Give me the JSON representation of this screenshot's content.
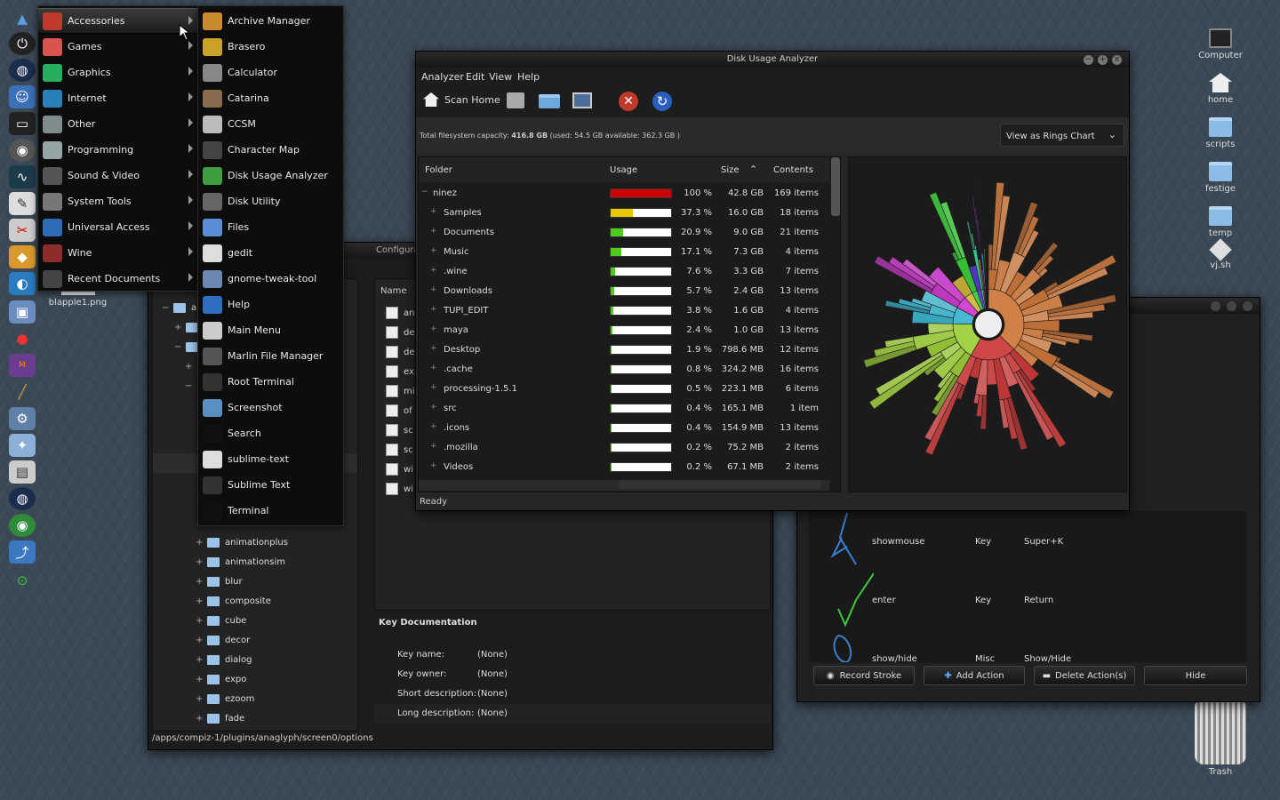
{
  "apps_menu": {
    "categories": [
      {
        "label": "Accessories",
        "icon": "accessories-icon",
        "color": "#c0392b"
      },
      {
        "label": "Games",
        "icon": "games-icon",
        "color": "#d9534f"
      },
      {
        "label": "Graphics",
        "icon": "graphics-icon",
        "color": "#27ae60"
      },
      {
        "label": "Internet",
        "icon": "internet-icon",
        "color": "#2980b9"
      },
      {
        "label": "Other",
        "icon": "other-icon",
        "color": "#7f8c8d"
      },
      {
        "label": "Programming",
        "icon": "programming-icon",
        "color": "#95a5a6"
      },
      {
        "label": "Sound & Video",
        "icon": "sound-video-icon",
        "color": "#555"
      },
      {
        "label": "System Tools",
        "icon": "system-tools-icon",
        "color": "#777"
      },
      {
        "label": "Universal Access",
        "icon": "universal-access-icon",
        "color": "#2c6db5"
      },
      {
        "label": "Wine",
        "icon": "wine-icon",
        "color": "#8e2b2b"
      },
      {
        "label": "Recent Documents",
        "icon": "recent-documents-icon",
        "color": "#444"
      }
    ],
    "accessories": [
      {
        "label": "Archive Manager",
        "icon": "archive-icon",
        "color": "#c98a2e"
      },
      {
        "label": "Brasero",
        "icon": "brasero-icon",
        "color": "#c9a226"
      },
      {
        "label": "Calculator",
        "icon": "calculator-icon",
        "color": "#888"
      },
      {
        "label": "Catarina",
        "icon": "catarina-icon",
        "color": "#8a6b4e"
      },
      {
        "label": "CCSM",
        "icon": "ccsm-icon",
        "color": "#bbb"
      },
      {
        "label": "Character Map",
        "icon": "character-map-icon",
        "color": "#444"
      },
      {
        "label": "Disk Usage Analyzer",
        "icon": "disk-usage-icon",
        "color": "#3f9e3f"
      },
      {
        "label": "Disk Utility",
        "icon": "disk-utility-icon",
        "color": "#666"
      },
      {
        "label": "Files",
        "icon": "files-icon",
        "color": "#5b8dd6"
      },
      {
        "label": "gedit",
        "icon": "gedit-icon",
        "color": "#ddd"
      },
      {
        "label": "gnome-tweak-tool",
        "icon": "tweak-tool-icon",
        "color": "#6a88b0"
      },
      {
        "label": "Help",
        "icon": "help-icon",
        "color": "#2f6fc0"
      },
      {
        "label": "Main Menu",
        "icon": "main-menu-icon",
        "color": "#ccc"
      },
      {
        "label": "Marlin File Manager",
        "icon": "marlin-icon",
        "color": "#555"
      },
      {
        "label": "Root Terminal",
        "icon": "root-terminal-icon",
        "color": "#333"
      },
      {
        "label": "Screenshot",
        "icon": "screenshot-icon",
        "color": "#5a8fc0"
      },
      {
        "label": "Search",
        "icon": "search-icon",
        "color": "#111"
      },
      {
        "label": "sublime-text",
        "icon": "sublime-text-icon",
        "color": "#ddd"
      },
      {
        "label": "Sublime Text",
        "icon": "sublime-icon",
        "color": "#333"
      },
      {
        "label": "Terminal",
        "icon": "terminal-icon",
        "color": "#111"
      }
    ]
  },
  "desktop": {
    "icons": [
      {
        "label": "Computer",
        "icon": "computer-icon"
      },
      {
        "label": "home",
        "icon": "home-icon"
      },
      {
        "label": "scripts",
        "icon": "folder-icon"
      },
      {
        "label": "festige",
        "icon": "folder-icon"
      },
      {
        "label": "temp",
        "icon": "folder-icon"
      },
      {
        "label": "vj.sh",
        "icon": "script-icon"
      }
    ],
    "trash": "Trash",
    "file": "blapple1.png"
  },
  "baobab": {
    "title": "Disk Usage Analyzer",
    "menu": [
      "Analyzer",
      "Edit",
      "View",
      "Help"
    ],
    "toolbar": {
      "scan_home": "Scan Home"
    },
    "capacity_prefix": "Total filesystem capacity: ",
    "capacity_value": "416.8 GB",
    "capacity_suffix": " (used: 54.5 GB available: 362.3 GB )",
    "view_select": "View as Rings Chart",
    "columns": {
      "folder": "Folder",
      "usage": "Usage",
      "size": "Size",
      "contents": "Contents"
    },
    "rows": [
      {
        "exp": "−",
        "name": "ninez",
        "pct": "100 %",
        "size": "42.8 GB",
        "contents": "169 items",
        "fill": 1.0,
        "color": "#cc0000"
      },
      {
        "exp": "+",
        "name": "Samples",
        "pct": "37.3 %",
        "size": "16.0 GB",
        "contents": "18 items",
        "fill": 0.373,
        "color": "#e6c800"
      },
      {
        "exp": "+",
        "name": "Documents",
        "pct": "20.9 %",
        "size": "9.0 GB",
        "contents": "21 items",
        "fill": 0.209,
        "color": "#4ecc1e"
      },
      {
        "exp": "+",
        "name": "Music",
        "pct": "17.1 %",
        "size": "7.3 GB",
        "contents": "4 items",
        "fill": 0.171,
        "color": "#4ecc1e"
      },
      {
        "exp": "+",
        "name": ".wine",
        "pct": "7.6 %",
        "size": "3.3 GB",
        "contents": "7 items",
        "fill": 0.076,
        "color": "#4ecc1e"
      },
      {
        "exp": "+",
        "name": "Downloads",
        "pct": "5.7 %",
        "size": "2.4 GB",
        "contents": "13 items",
        "fill": 0.057,
        "color": "#4ecc1e"
      },
      {
        "exp": "+",
        "name": "TUPI_EDIT",
        "pct": "3.8 %",
        "size": "1.6 GB",
        "contents": "4 items",
        "fill": 0.038,
        "color": "#4ecc1e"
      },
      {
        "exp": "+",
        "name": "maya",
        "pct": "2.4 %",
        "size": "1.0 GB",
        "contents": "13 items",
        "fill": 0.024,
        "color": "#4ecc1e"
      },
      {
        "exp": "+",
        "name": "Desktop",
        "pct": "1.9 %",
        "size": "798.6 MB",
        "contents": "12 items",
        "fill": 0.019,
        "color": "#4ecc1e"
      },
      {
        "exp": "+",
        "name": ".cache",
        "pct": "0.8 %",
        "size": "324.2 MB",
        "contents": "16 items",
        "fill": 0.008,
        "color": "#4ecc1e"
      },
      {
        "exp": "+",
        "name": "processing-1.5.1",
        "pct": "0.5 %",
        "size": "223.1 MB",
        "contents": "6 items",
        "fill": 0.005,
        "color": "#4ecc1e"
      },
      {
        "exp": "+",
        "name": "src",
        "pct": "0.4 %",
        "size": "165.1 MB",
        "contents": "1 item",
        "fill": 0.004,
        "color": "#4ecc1e"
      },
      {
        "exp": "+",
        "name": ".icons",
        "pct": "0.4 %",
        "size": "154.9 MB",
        "contents": "13 items",
        "fill": 0.004,
        "color": "#4ecc1e"
      },
      {
        "exp": "+",
        "name": ".mozilla",
        "pct": "0.2 %",
        "size": "75.2 MB",
        "contents": "2 items",
        "fill": 0.002,
        "color": "#4ecc1e"
      },
      {
        "exp": "+",
        "name": "Videos",
        "pct": "0.2 %",
        "size": "67.1 MB",
        "contents": "2 items",
        "fill": 0.002,
        "color": "#4ecc1e"
      }
    ],
    "status": "Ready"
  },
  "ccsm": {
    "title": "Configura",
    "name_col": "Name",
    "options": [
      "an",
      "de",
      "de",
      "ex",
      "mi",
      "of",
      "sc",
      "sc",
      "wi",
      "wi"
    ],
    "tree_top": [
      "ap",
      "",
      ""
    ],
    "tree": [
      "animationplus",
      "animationsim",
      "blur",
      "composite",
      "cube",
      "decor",
      "dialog",
      "expo",
      "ezoom",
      "fade"
    ],
    "keydoc_title": "Key Documentation",
    "keydoc": [
      {
        "k": "Key name:",
        "v": "(None)"
      },
      {
        "k": "Key owner:",
        "v": "(None)"
      },
      {
        "k": "Short description:",
        "v": "(None)"
      },
      {
        "k": "Long description:",
        "v": "(None)"
      }
    ],
    "path": "/apps/compiz-1/plugins/anaglyph/screen0/options"
  },
  "gestures": {
    "rows": [
      {
        "name": "showmouse",
        "type": "Key",
        "value": "Super+K"
      },
      {
        "name": "enter",
        "type": "Key",
        "value": "Return"
      },
      {
        "name": "show/hide",
        "type": "Misc",
        "value": "Show/Hide"
      }
    ],
    "buttons": {
      "record": "Record Stroke",
      "add": "Add Action",
      "delete": "Delete Action(s)",
      "hide": "Hide"
    }
  }
}
